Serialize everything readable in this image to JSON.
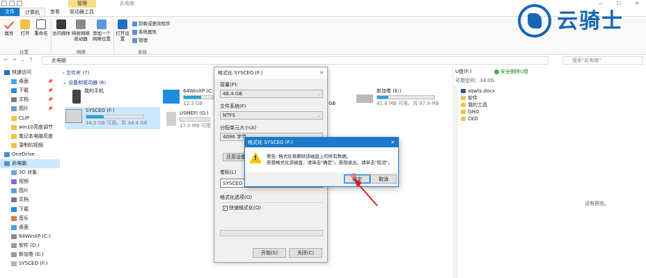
{
  "window": {
    "context_tab": "管理",
    "title": "此电脑",
    "controls": [
      "—",
      "☐",
      "✕"
    ]
  },
  "ribbon": {
    "tabs": [
      "文件",
      "计算机",
      "查看",
      "驱动器工具"
    ],
    "buttons": [
      {
        "label": "属性",
        "icon": "properties-icon"
      },
      {
        "label": "打开",
        "icon": "folder-open-icon"
      },
      {
        "label": "重命名",
        "icon": "rename-icon"
      },
      {
        "label": "访问媒体",
        "icon": "media-access-icon"
      },
      {
        "label": "映射网络驱动器",
        "icon": "map-drive-icon"
      },
      {
        "label": "添加一个网络位置",
        "icon": "network-location-icon"
      },
      {
        "label": "打开设置",
        "icon": "settings-icon"
      }
    ],
    "small_buttons": [
      "卸载或更改程序",
      "系统属性",
      "管理"
    ],
    "groups": [
      "位置",
      "网络",
      "系统"
    ]
  },
  "address": {
    "path": "此电脑",
    "search_placeholder": "搜索\"此电脑\""
  },
  "navpane": {
    "items": [
      {
        "label": "快速访问",
        "pinned": false
      },
      {
        "label": "桌面",
        "pinned": true
      },
      {
        "label": "下载",
        "pinned": true
      },
      {
        "label": "文档",
        "pinned": true
      },
      {
        "label": "图片",
        "pinned": true
      },
      {
        "label": "CLIP",
        "pinned": false
      },
      {
        "label": "win10亮度调节",
        "pinned": false
      },
      {
        "label": "笔记本电脑亮度",
        "pinned": false
      },
      {
        "label": "录制的视频",
        "pinned": false
      },
      {
        "label": "OneDrive",
        "pinned": false
      },
      {
        "label": "此电脑",
        "pinned": false
      },
      {
        "label": "3D 对象",
        "pinned": false
      },
      {
        "label": "视频",
        "pinned": false
      },
      {
        "label": "图片",
        "pinned": false
      },
      {
        "label": "文档",
        "pinned": false
      },
      {
        "label": "下载",
        "pinned": false
      },
      {
        "label": "音乐",
        "pinned": false
      },
      {
        "label": "桌面",
        "pinned": false
      },
      {
        "label": "64WinXP (C:)",
        "pinned": false
      },
      {
        "label": "软件 (D:)",
        "pinned": false
      },
      {
        "label": "新加卷 (E:)",
        "pinned": false
      },
      {
        "label": "SYSCEO (F:)",
        "pinned": false
      }
    ]
  },
  "content": {
    "folders_header": "文件夹 (7)",
    "devices_header": "设备和驱动器 (6)",
    "drives": [
      {
        "name": "我的手机",
        "info": "",
        "fill": 0
      },
      {
        "name": "SYSCEO (F:)",
        "info": "34.0 GB 可用，共 48.4 GB",
        "fill": 0.3
      },
      {
        "name": "64WinXP (C:)",
        "info": "12.3 GB",
        "fill": 0.6
      },
      {
        "name": "USMEFI (G:)",
        "info": "17.0 MB 可用",
        "fill": 0
      },
      {
        "name": "新加卷 (E:)",
        "info": "81.8 MB 可用，共 97.9 MB",
        "fill": 0.2
      },
      {
        "name": "GB",
        "info": "",
        "fill": 0
      }
    ]
  },
  "details": {
    "drive_label": "U盘(F:)",
    "safe_label": "安全删除U盘",
    "free_text": "可用空间：34.0G",
    "files": [
      "sqwts.docx",
      "软件",
      "我的工具",
      "GHO",
      "CEO"
    ],
    "no_preview": "没有预览。"
  },
  "format_dialog": {
    "title": "格式化 SYSCEO (F:)",
    "capacity_label": "容量(P):",
    "capacity_value": "48.4 GB",
    "fs_label": "文件系统(F)",
    "fs_value": "NTFS",
    "alloc_label": "分配单元大小(A)",
    "alloc_value": "4096 字节",
    "restore_label": "还原设备",
    "volume_label": "卷标(L)",
    "volume_value": "SYSCEO",
    "options_label": "格式化选项(O)",
    "quick_label": "快速格式化(Q)",
    "quick_checked": true,
    "start_label": "开始(S)",
    "close_label": "关闭(C)"
  },
  "confirm_dialog": {
    "title": "格式化 SYSCEO (F:)",
    "line1": "警告: 格式化将删除该磁盘上的所有数据。",
    "line2": "若想格式化该磁盘，请单击\"确定\"。若想退出，请单击\"取消\"。",
    "ok_label": "确定",
    "cancel_label": "取消"
  },
  "logo": {
    "text": "云骑士"
  }
}
